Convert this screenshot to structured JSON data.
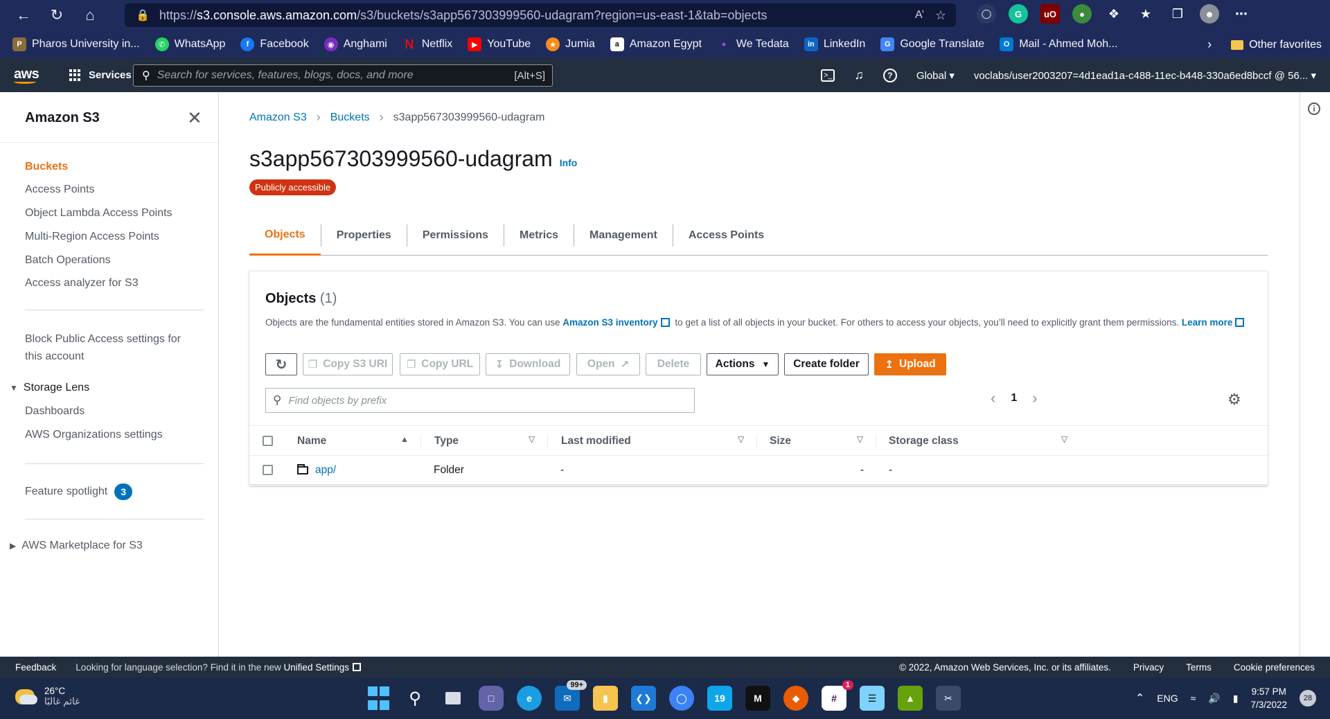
{
  "browser": {
    "url_prefix": "https://",
    "url_host": "s3.console.aws.amazon.com",
    "url_rest": "/s3/buckets/s3app567303999560-udagram?region=us-east-1&tab=objects",
    "bookmarks": [
      "Pharos University in...",
      "WhatsApp",
      "Facebook",
      "Anghami",
      "Netflix",
      "YouTube",
      "Jumia",
      "Amazon Egypt",
      "We Tedata",
      "LinkedIn",
      "Google Translate",
      "Mail - Ahmed Moh..."
    ],
    "other_favorites": "Other favorites"
  },
  "aws_nav": {
    "logo": "aws",
    "services": "Services",
    "search_placeholder": "Search for services, features, blogs, docs, and more",
    "search_shortcut": "[Alt+S]",
    "region": "Global",
    "account": "voclabs/user2003207=4d1ead1a-c488-11ec-b448-330a6ed8bccf @ 56..."
  },
  "sidebar": {
    "title": "Amazon S3",
    "items": [
      "Buckets",
      "Access Points",
      "Object Lambda Access Points",
      "Multi-Region Access Points",
      "Batch Operations",
      "Access analyzer for S3"
    ],
    "block_public_line1": "Block Public Access settings for",
    "block_public_line2": "this account",
    "storage_lens": "Storage Lens",
    "storage_lens_items": [
      "Dashboards",
      "AWS Organizations settings"
    ],
    "feature_spotlight": "Feature spotlight",
    "feature_count": "3",
    "marketplace": "AWS Marketplace for S3"
  },
  "breadcrumb": [
    "Amazon S3",
    "Buckets",
    "s3app567303999560-udagram"
  ],
  "page": {
    "title": "s3app567303999560-udagram",
    "info": "Info",
    "badge": "Publicly accessible"
  },
  "tabs": [
    "Objects",
    "Properties",
    "Permissions",
    "Metrics",
    "Management",
    "Access Points"
  ],
  "objects": {
    "title": "Objects",
    "count": "(1)",
    "desc_1": "Objects are the fundamental entities stored in Amazon S3. You can use ",
    "desc_link": "Amazon S3 inventory",
    "desc_2": " to get a list of all objects in your bucket. For others to access your objects, you’ll need to explicitly grant them permissions. ",
    "desc_learn": "Learn more",
    "buttons": {
      "copy_uri": "Copy S3 URI",
      "copy_url": "Copy URL",
      "download": "Download",
      "open": "Open",
      "delete": "Delete",
      "actions": "Actions",
      "create_folder": "Create folder",
      "upload": "Upload"
    },
    "search_placeholder": "Find objects by prefix",
    "page": "1",
    "columns": [
      "Name",
      "Type",
      "Last modified",
      "Size",
      "Storage class"
    ],
    "rows": [
      {
        "name": "app/",
        "type": "Folder",
        "last_modified": "-",
        "size": "-",
        "storage_class": "-"
      }
    ]
  },
  "footer": {
    "feedback": "Feedback",
    "lang_text": "Looking for language selection? Find it in the new ",
    "lang_link": "Unified Settings",
    "copyright": "© 2022, Amazon Web Services, Inc. or its affiliates.",
    "privacy": "Privacy",
    "terms": "Terms",
    "cookies": "Cookie preferences"
  },
  "taskbar": {
    "temp": "26°C",
    "weather_desc": "غائم غالبًا",
    "mail_badge": "99+",
    "slack_badge": "1",
    "lang": "ENG",
    "time": "9:57 PM",
    "date": "7/3/2022",
    "notif": "28"
  }
}
